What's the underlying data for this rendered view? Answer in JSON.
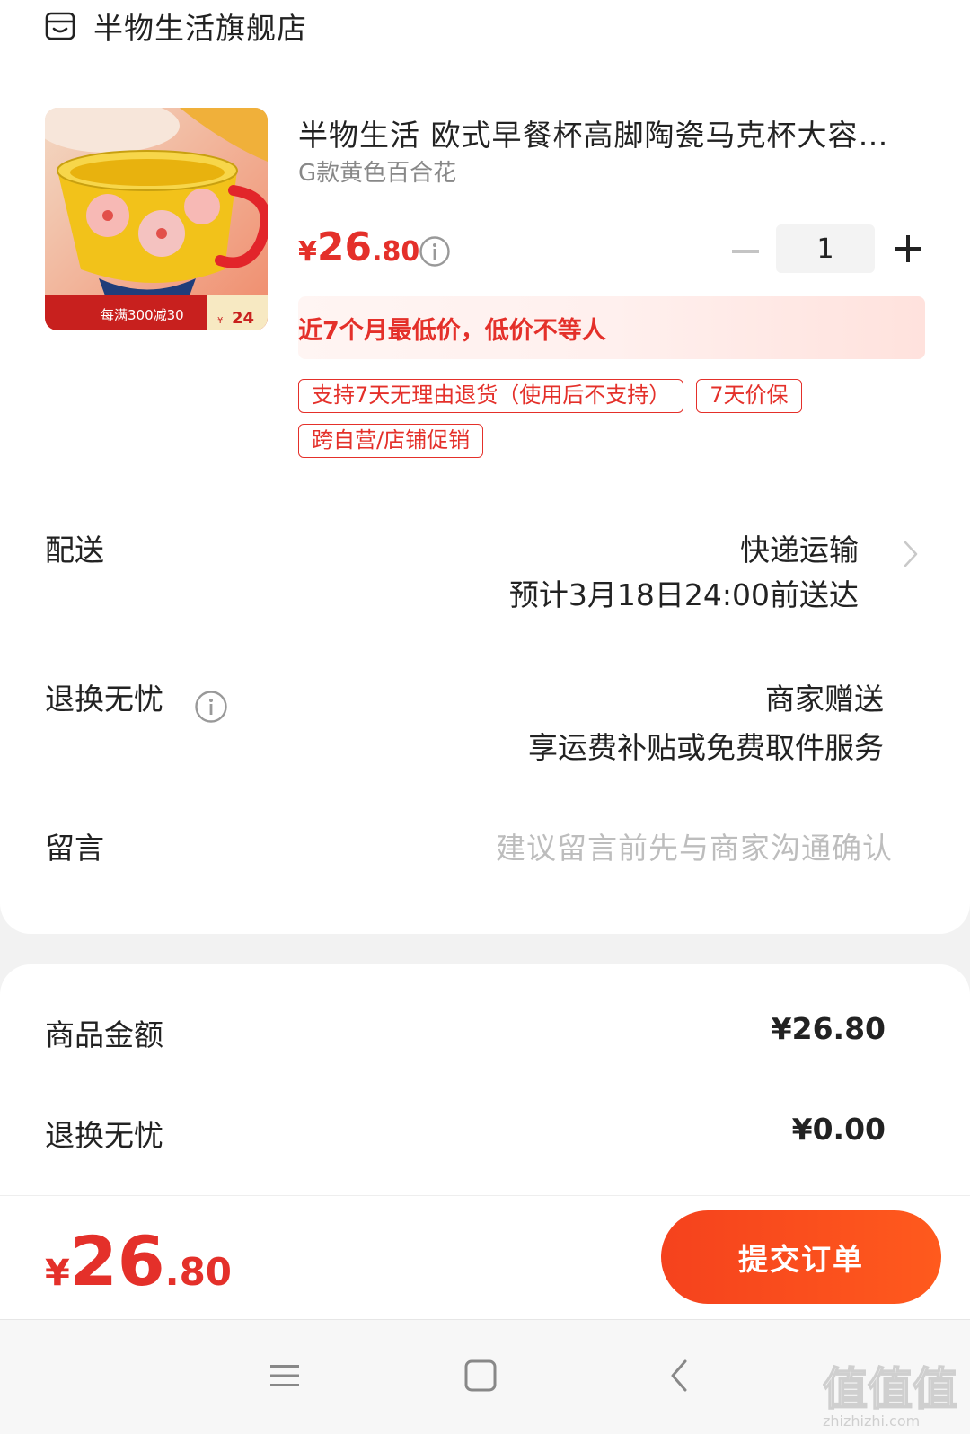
{
  "store": {
    "name": "半物生活旗舰店",
    "icon": "store-icon"
  },
  "product": {
    "title": "半物生活 欧式早餐杯高脚陶瓷马克杯大容…",
    "sku": "G款黄色百合花",
    "image": {
      "alt": "mug",
      "badge_text": "每满300减30",
      "badge_price": "24",
      "badge_symbol": "¥"
    },
    "price": {
      "symbol": "¥",
      "integer": "26",
      "decimal": ".80"
    },
    "quantity": "1",
    "lowest_price_note": "近7个月最低价，低价不等人",
    "tags": [
      "支持7天无理由退货（使用后不支持）",
      "7天价保",
      "跨自营/店铺促销"
    ]
  },
  "delivery": {
    "label": "配送",
    "method": "快递运输",
    "eta": "预计3月18日24:00前送达"
  },
  "return_worry_free": {
    "label": "退换无忧",
    "line1": "商家赠送",
    "line2": "享运费补贴或免费取件服务"
  },
  "message": {
    "label": "留言",
    "placeholder": "建议留言前先与商家沟通确认"
  },
  "summary": {
    "goods_label": "商品金额",
    "goods_value": "¥26.80",
    "return_label": "退换无忧",
    "return_value": "¥0.00"
  },
  "footer": {
    "total": {
      "symbol": "¥",
      "integer": "26",
      "decimal": ".80"
    },
    "submit_label": "提交订单"
  },
  "navbar": {
    "icons": [
      "menu-icon",
      "home-icon",
      "back-icon"
    ]
  },
  "watermark": {
    "text": "值值值",
    "subtext": "zhizhizhi.com"
  },
  "colors": {
    "accent": "#e4302a",
    "button": "#f5421d",
    "placeholder": "#bdbdbd"
  }
}
